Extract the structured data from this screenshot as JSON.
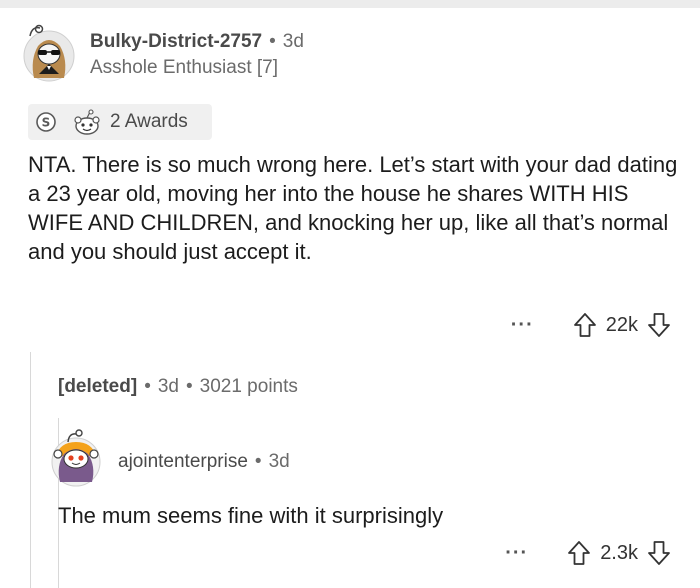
{
  "comment1": {
    "username": "Bulky-District-2757",
    "age": "3d",
    "flair": "Asshole Enthusiast [7]",
    "awards_label": "2 Awards",
    "body": "NTA. There is so much wrong here. Let’s start with your dad dating a 23 year old, moving her into the house he shares WITH HIS WIFE AND CHILDREN, and knocking her up, like all that’s normal and you should just accept it.",
    "more": "···",
    "score": "22k"
  },
  "comment2": {
    "username": "[deleted]",
    "age": "3d",
    "points": "3021 points"
  },
  "comment3": {
    "username": "ajointenterprise",
    "age": "3d",
    "body": "The mum seems fine with it surprisingly",
    "more": "···",
    "score": "2.3k"
  },
  "icons": [
    "avatar",
    "silver-award-icon",
    "wholesome-award-icon",
    "upvote-icon",
    "downvote-icon"
  ],
  "colors": {
    "meta_gray": "#6b6b6b",
    "awards_bg": "#f0f0f0",
    "thread_line": "#d8d8d8"
  }
}
